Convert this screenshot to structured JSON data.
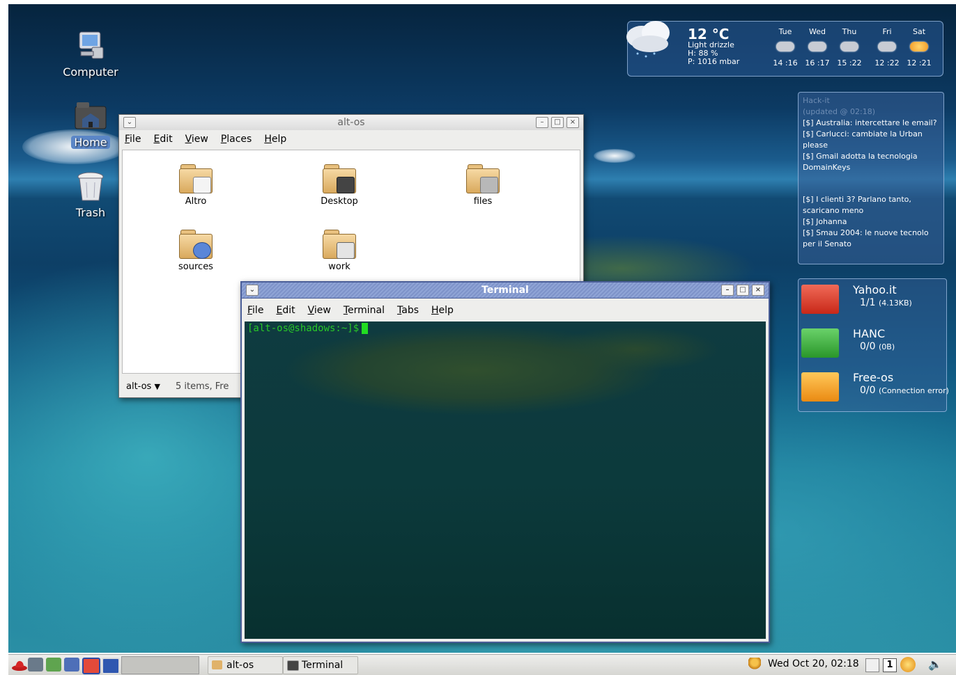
{
  "desktop": {
    "icons": [
      {
        "label": "Computer"
      },
      {
        "label": "Home"
      },
      {
        "label": "Trash"
      }
    ]
  },
  "file_manager": {
    "title": "alt-os",
    "menu": [
      "File",
      "Edit",
      "View",
      "Places",
      "Help"
    ],
    "items": [
      "Altro",
      "Desktop",
      "files",
      "sources",
      "work"
    ],
    "location": "alt-os",
    "status": "5 items, Fre"
  },
  "terminal": {
    "title": "Terminal",
    "menu": [
      "File",
      "Edit",
      "View",
      "Terminal",
      "Tabs",
      "Help"
    ],
    "prompt": "[alt-os@shadows:~]$"
  },
  "weather": {
    "temp": "12 °C",
    "condition": "Light drizzle",
    "humidity": "H: 88 %",
    "pressure": "P: 1016 mbar",
    "forecast": [
      {
        "day": "Tue",
        "temps": "14 :16"
      },
      {
        "day": "Wed",
        "temps": "16 :17"
      },
      {
        "day": "Thu",
        "temps": "15 :22"
      },
      {
        "day": "Fri",
        "temps": "12 :22"
      },
      {
        "day": "Sat",
        "temps": "12 :21"
      }
    ]
  },
  "news": {
    "header": "Hack-it",
    "updated": "(updated @ 02:18)",
    "items": [
      "[$] Australia: intercettare le email?",
      "[$] Carlucci: cambiate la Urban please",
      "[$] Gmail adotta la tecnologia DomainKeys",
      "[$] I clienti 3? Parlano tanto, scaricano meno",
      "[$] Johanna",
      "[$] Smau 2004: le nuove tecnolo per il Senato"
    ]
  },
  "mail": [
    {
      "name": "Yahoo.it",
      "count": "1/1",
      "detail": "(4.13KB)",
      "color": "#d83a2a"
    },
    {
      "name": "HANC",
      "count": "0/0",
      "detail": "(0B)",
      "color": "#3aa83a"
    },
    {
      "name": "Free-os",
      "count": "0/0",
      "detail": "(Connection error)",
      "color": "#f0a22a"
    }
  ],
  "taskbar": {
    "tasks": [
      "alt-os",
      "Terminal"
    ],
    "clock": "Wed Oct 20, 02:18",
    "workspace": "1"
  }
}
